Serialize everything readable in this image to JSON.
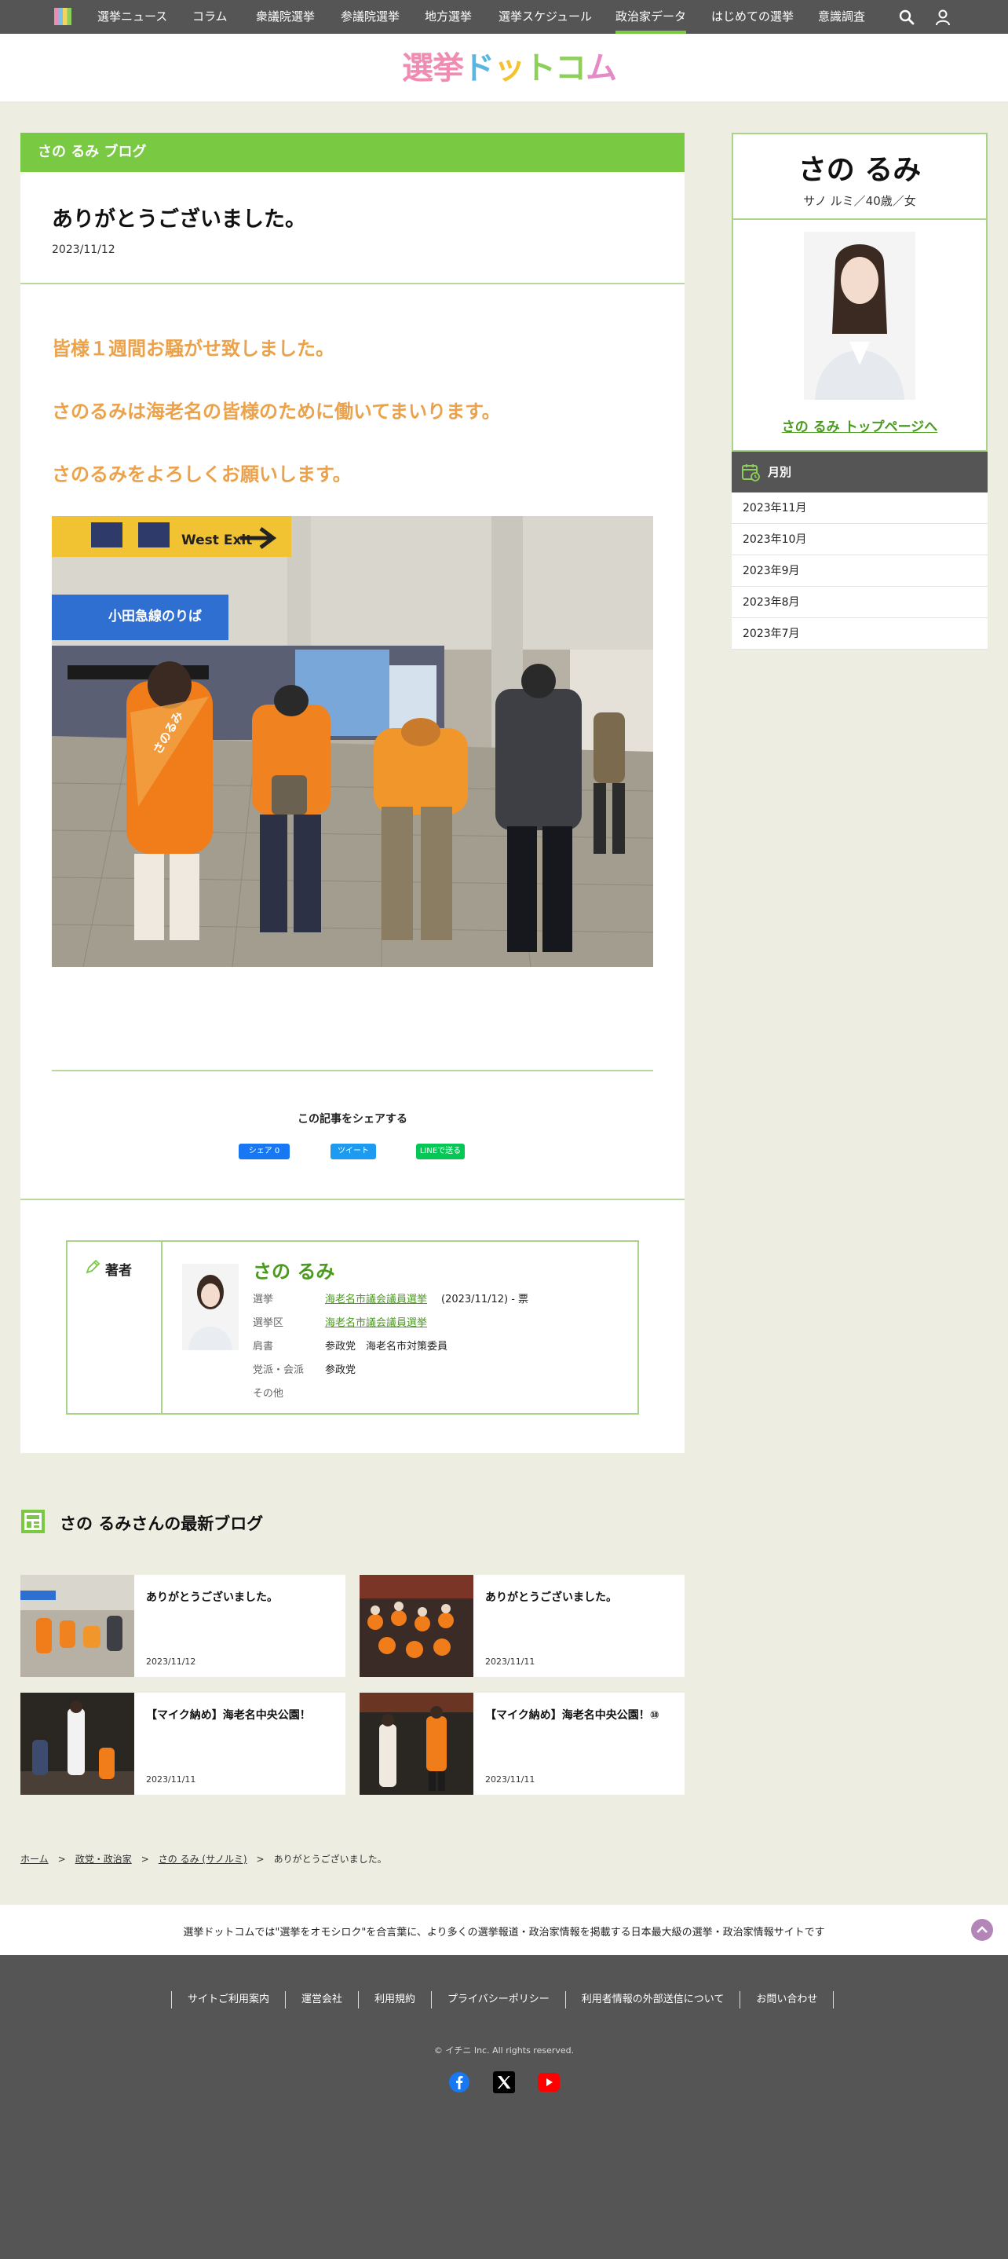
{
  "nav": {
    "items": [
      "選挙ニュース",
      "コラム",
      "衆議院選挙",
      "参議院選挙",
      "地方選挙",
      "選挙スケジュール",
      "政治家データ",
      "はじめての選挙",
      "意識調査"
    ],
    "active_index": 6,
    "search_icon": "search-icon",
    "user_icon": "user-icon"
  },
  "header": {
    "logo_parts": [
      "選",
      "挙",
      "ド",
      "ッ",
      "ト",
      "コ",
      "ム"
    ]
  },
  "article": {
    "blog_label": "さの るみ ブログ",
    "title": "ありがとうございました。",
    "date": "2023/11/12",
    "body": [
      "皆様１週間お騒がせ致しました。",
      "さのるみは海老名の皆様のために働いてまいります。",
      "さのるみをよろしくお願いします。"
    ],
    "photo_signs": {
      "west_exit": "West Exit",
      "odakyu": "小田急線のりば",
      "sash": "さのるみ"
    },
    "share": {
      "title": "この記事をシェアする",
      "facebook": "シェア 0",
      "twitter": "ツイート",
      "line": "LINEで送る"
    }
  },
  "author": {
    "label": "著者",
    "name": "さの るみ",
    "rows": [
      {
        "k": "選挙",
        "v": "海老名市議会議員選挙",
        "extra": "(2023/11/12) - 票",
        "link": true
      },
      {
        "k": "選挙区",
        "v": "海老名市議会議員選挙",
        "extra": "",
        "link": true
      },
      {
        "k": "肩書",
        "v": "参政党　海老名市対策委員",
        "extra": "",
        "link": false
      },
      {
        "k": "党派・会派",
        "v": "参政党",
        "extra": "",
        "link": false
      },
      {
        "k": "その他",
        "v": "",
        "extra": "",
        "link": false
      }
    ]
  },
  "sidebar": {
    "name": "さの るみ",
    "kana_age": "サノ ルミ／40歳／女",
    "top_link": "さの るみ トップページへ",
    "monthly_label": "月別",
    "months": [
      "2023年11月",
      "2023年10月",
      "2023年9月",
      "2023年8月",
      "2023年7月"
    ]
  },
  "latest": {
    "heading": "さの るみさんの最新ブログ",
    "cards": [
      {
        "title": "ありがとうございました。",
        "date": "2023/11/12"
      },
      {
        "title": "ありがとうございました。",
        "date": "2023/11/11"
      },
      {
        "title": "【マイク納め】海老名中央公園！",
        "date": "2023/11/11"
      },
      {
        "title": "【マイク納め】海老名中央公園！⑩",
        "date": "2023/11/11"
      }
    ]
  },
  "breadcrumb": {
    "items": [
      "ホーム",
      "政党・政治家",
      "さの るみ (サノルミ)",
      "ありがとうございました。"
    ]
  },
  "footer": {
    "tagline": "選挙ドットコムでは\"選挙をオモシロク\"を合言葉に、より多くの選挙報道・政治家情報を掲載する日本最大級の選挙・政治家情報サイトです",
    "links": [
      "サイトご利用案内",
      "運営会社",
      "利用規約",
      "プライバシーポリシー",
      "利用者情報の外部送信について",
      "お問い合わせ"
    ],
    "copyright": "© イチニ Inc. All rights reserved.",
    "social_icons": [
      "facebook-icon",
      "x-icon",
      "youtube-icon"
    ]
  },
  "colors": {
    "accent_green": "#7ac943",
    "link_green": "#4a9a1e",
    "body_orange": "#eba24a",
    "nav_gray": "#555555",
    "bg": "#eeede2"
  }
}
